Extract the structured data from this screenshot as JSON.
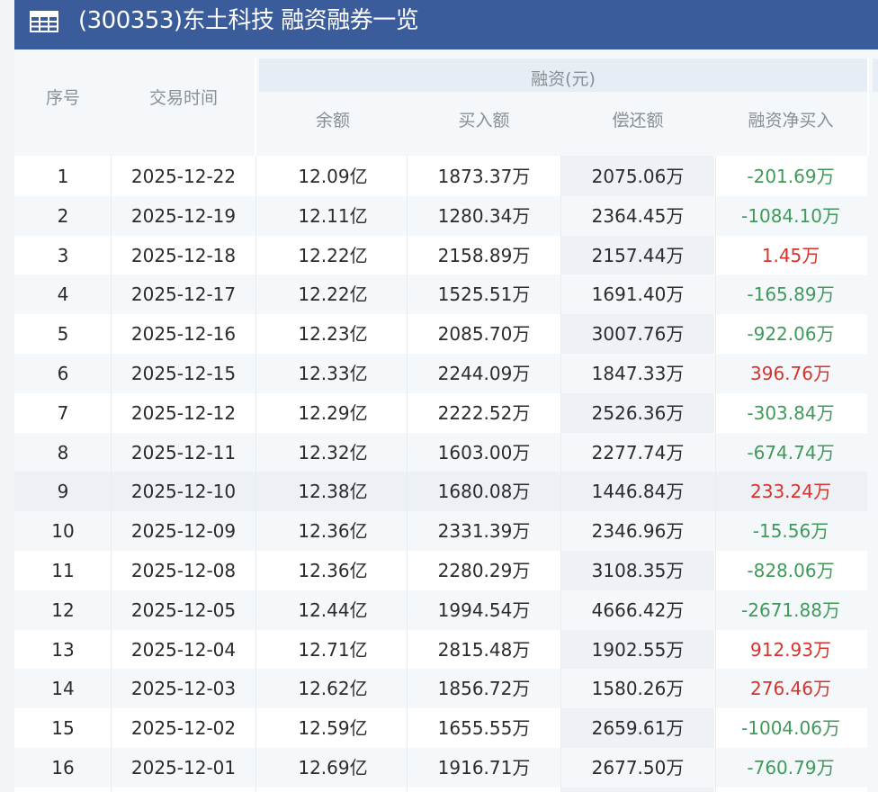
{
  "title": "(300353)东土科技 融资融券一览",
  "title_icon": "table-grid-icon",
  "headers": {
    "index": "序号",
    "date": "交易时间",
    "group": "融资(元)",
    "balance": "余额",
    "buy": "买入额",
    "repay": "偿还额",
    "net_buy": "融资净买入"
  },
  "colors": {
    "title_bar": "#3b5c9b",
    "positive": "#d9322b",
    "negative": "#3f9a5a"
  },
  "rows": [
    {
      "index": "1",
      "date": "2025-12-22",
      "balance": "12.09亿",
      "buy": "1873.37万",
      "repay": "2075.06万",
      "net": "-201.69万"
    },
    {
      "index": "2",
      "date": "2025-12-19",
      "balance": "12.11亿",
      "buy": "1280.34万",
      "repay": "2364.45万",
      "net": "-1084.10万"
    },
    {
      "index": "3",
      "date": "2025-12-18",
      "balance": "12.22亿",
      "buy": "2158.89万",
      "repay": "2157.44万",
      "net": "1.45万"
    },
    {
      "index": "4",
      "date": "2025-12-17",
      "balance": "12.22亿",
      "buy": "1525.51万",
      "repay": "1691.40万",
      "net": "-165.89万"
    },
    {
      "index": "5",
      "date": "2025-12-16",
      "balance": "12.23亿",
      "buy": "2085.70万",
      "repay": "3007.76万",
      "net": "-922.06万"
    },
    {
      "index": "6",
      "date": "2025-12-15",
      "balance": "12.33亿",
      "buy": "2244.09万",
      "repay": "1847.33万",
      "net": "396.76万"
    },
    {
      "index": "7",
      "date": "2025-12-12",
      "balance": "12.29亿",
      "buy": "2222.52万",
      "repay": "2526.36万",
      "net": "-303.84万"
    },
    {
      "index": "8",
      "date": "2025-12-11",
      "balance": "12.32亿",
      "buy": "1603.00万",
      "repay": "2277.74万",
      "net": "-674.74万"
    },
    {
      "index": "9",
      "date": "2025-12-10",
      "balance": "12.38亿",
      "buy": "1680.08万",
      "repay": "1446.84万",
      "net": "233.24万"
    },
    {
      "index": "10",
      "date": "2025-12-09",
      "balance": "12.36亿",
      "buy": "2331.39万",
      "repay": "2346.96万",
      "net": "-15.56万"
    },
    {
      "index": "11",
      "date": "2025-12-08",
      "balance": "12.36亿",
      "buy": "2280.29万",
      "repay": "3108.35万",
      "net": "-828.06万"
    },
    {
      "index": "12",
      "date": "2025-12-05",
      "balance": "12.44亿",
      "buy": "1994.54万",
      "repay": "4666.42万",
      "net": "-2671.88万"
    },
    {
      "index": "13",
      "date": "2025-12-04",
      "balance": "12.71亿",
      "buy": "2815.48万",
      "repay": "1902.55万",
      "net": "912.93万"
    },
    {
      "index": "14",
      "date": "2025-12-03",
      "balance": "12.62亿",
      "buy": "1856.72万",
      "repay": "1580.26万",
      "net": "276.46万"
    },
    {
      "index": "15",
      "date": "2025-12-02",
      "balance": "12.59亿",
      "buy": "1655.55万",
      "repay": "2659.61万",
      "net": "-1004.06万"
    },
    {
      "index": "16",
      "date": "2025-12-01",
      "balance": "12.69亿",
      "buy": "1916.71万",
      "repay": "2677.50万",
      "net": "-760.79万"
    }
  ]
}
